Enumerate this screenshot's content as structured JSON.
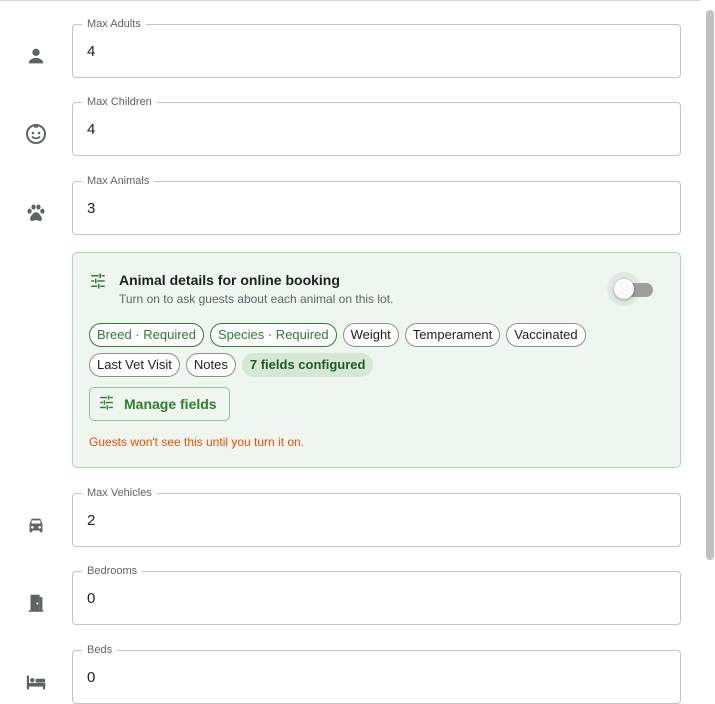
{
  "fields": {
    "max_adults": {
      "label": "Max Adults",
      "value": "4"
    },
    "max_children": {
      "label": "Max Children",
      "value": "4"
    },
    "max_animals": {
      "label": "Max Animals",
      "value": "3"
    },
    "max_vehicles": {
      "label": "Max Vehicles",
      "value": "2"
    },
    "bedrooms": {
      "label": "Bedrooms",
      "value": "0"
    },
    "beds": {
      "label": "Beds",
      "value": "0"
    }
  },
  "animal_panel": {
    "title": "Animal details for online booking",
    "description": "Turn on to ask guests about each animal on this lot.",
    "toggle_on": false,
    "chips": [
      {
        "label": "Breed · Required",
        "required": true
      },
      {
        "label": "Species · Required",
        "required": true
      },
      {
        "label": "Weight",
        "required": false
      },
      {
        "label": "Temperament",
        "required": false
      },
      {
        "label": "Vaccinated",
        "required": false
      },
      {
        "label": "Last Vet Visit",
        "required": false
      },
      {
        "label": "Notes",
        "required": false
      }
    ],
    "count_chip": "7 fields configured",
    "manage_label": "Manage fields",
    "warning": "Guests won't see this until you turn it on."
  },
  "icons": {
    "adults": "person-icon",
    "children": "child-face-icon",
    "animals": "paw-icon",
    "vehicles": "car-icon",
    "bedrooms": "door-icon",
    "beds": "bed-icon",
    "tune": "tune-icon"
  },
  "colors": {
    "accent": "#2e7d32",
    "panel_bg": "#eef6ef",
    "warning": "#e65100"
  }
}
